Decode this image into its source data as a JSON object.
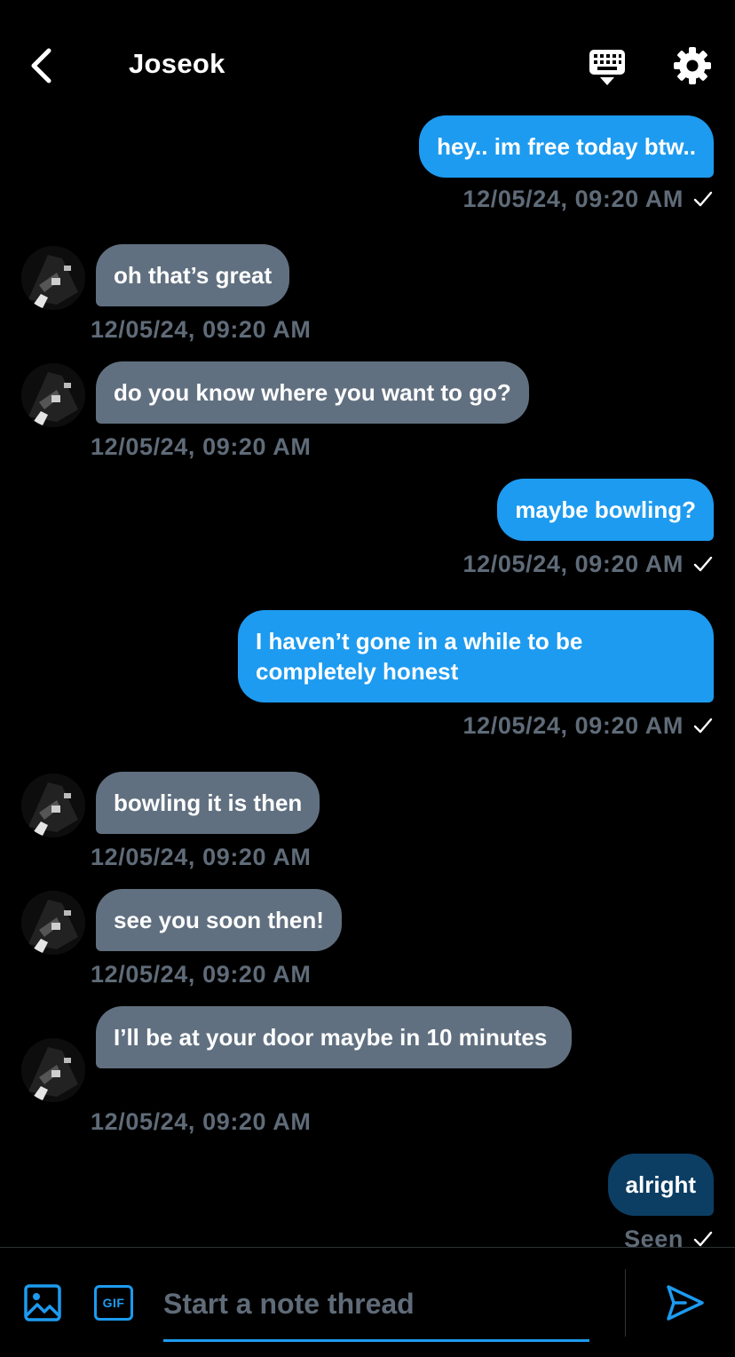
{
  "header": {
    "title": "Joseok",
    "back_icon": "chevron-left-icon",
    "keyboard_icon": "keyboard-icon",
    "settings_icon": "gear-icon"
  },
  "messages": [
    {
      "dir": "out",
      "text": "hey.. im free today btw..",
      "time": "12/05/24, 09:20 AM"
    },
    {
      "dir": "in",
      "text": "oh that’s great",
      "time": "12/05/24, 09:20 AM"
    },
    {
      "dir": "in",
      "text": "do you know where you want to go?",
      "time": "12/05/24, 09:20 AM"
    },
    {
      "dir": "out",
      "text": "maybe bowling?",
      "time": "12/05/24, 09:20 AM"
    },
    {
      "dir": "out",
      "text": "I haven’t gone in a while to be completely honest",
      "time": "12/05/24, 09:20 AM"
    },
    {
      "dir": "in",
      "text": "bowling it is then",
      "time": "12/05/24, 09:20 AM"
    },
    {
      "dir": "in",
      "text": "see you soon then!",
      "time": "12/05/24, 09:20 AM"
    },
    {
      "dir": "in",
      "text": "I’ll be at your door maybe in 10 minutes",
      "time": "12/05/24, 09:20 AM"
    },
    {
      "dir": "out",
      "text": "alright",
      "time": "Seen"
    }
  ],
  "composer": {
    "placeholder": "Start a note thread",
    "gif_label": "GIF",
    "image_icon": "image-icon",
    "send_icon": "send-icon"
  },
  "colors": {
    "outgoing_bubble": "#1d9bf0",
    "outgoing_bubble_last": "#0c3e63",
    "incoming_bubble": "#617080",
    "timestamp": "#5f6b78",
    "accent": "#1d9bf0",
    "background": "#000000"
  }
}
